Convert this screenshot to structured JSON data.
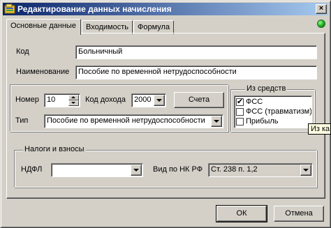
{
  "window": {
    "title": "Редактирование данных начисления",
    "close_label": "×",
    "status_color": "#1fb01f"
  },
  "tabs": [
    {
      "label": "Основные данные",
      "active": true
    },
    {
      "label": "Входимость",
      "active": false
    },
    {
      "label": "Формула",
      "active": false
    }
  ],
  "fields": {
    "kod": {
      "label": "Код",
      "value": "Больничный"
    },
    "naimenovanie": {
      "label": "Наименование",
      "value": "Пособие по временной нетрудоспособности"
    },
    "nomer": {
      "label": "Номер",
      "value": "10"
    },
    "kod_dohoda": {
      "label": "Код дохода",
      "value": "2000"
    },
    "tip": {
      "label": "Тип",
      "value": "Пособие по временной нетрудоспособности"
    }
  },
  "scheta_button": "Счета",
  "iz_sredstv": {
    "title": "Из средств",
    "items": [
      {
        "label": "ФСС",
        "checked": true
      },
      {
        "label": "ФСС (травматизм)",
        "checked": false
      },
      {
        "label": "Прибыль",
        "checked": false
      }
    ],
    "tooltip": "Из ка"
  },
  "taxes": {
    "title": "Налоги и взносы",
    "ndfl_label": "НДФЛ",
    "ndfl_value": "",
    "vid_label": "Вид по НК РФ",
    "vid_value": "Ст. 238 п. 1,2"
  },
  "footer": {
    "ok_label": "ОК",
    "cancel_label": "Отмена"
  }
}
